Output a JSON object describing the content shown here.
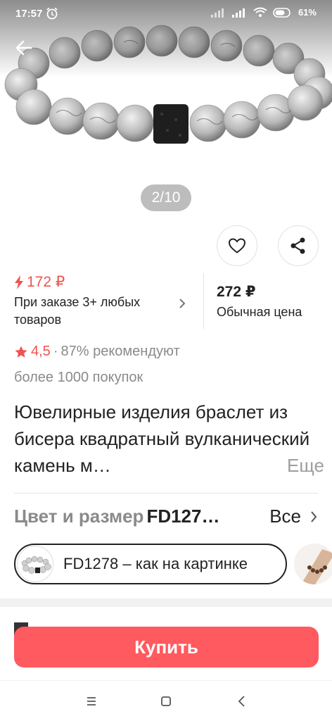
{
  "status_bar": {
    "time": "17:57",
    "battery": "61"
  },
  "gallery": {
    "pager": "2/10"
  },
  "price": {
    "discount": "172 ₽",
    "condition": "При заказе 3+ любых товаров",
    "regular": "272 ₽",
    "regular_label": "Обычная цена"
  },
  "rating": {
    "value": "4,5",
    "separator": "·",
    "recommend": "87% рекомендуют",
    "orders": "более 1000 покупок"
  },
  "product": {
    "title": "Ювелирные изделия браслет из бисера квадратный вулканический камень м…",
    "more": "Еще"
  },
  "variant": {
    "label": "Цвет и размер",
    "value": "FD127…",
    "all": "Все",
    "selected": "FD1278 – как на картинке"
  },
  "actions": {
    "buy": "Купить"
  },
  "colors": {
    "accent": "#ff5a5f",
    "discount": "#ef5350"
  }
}
